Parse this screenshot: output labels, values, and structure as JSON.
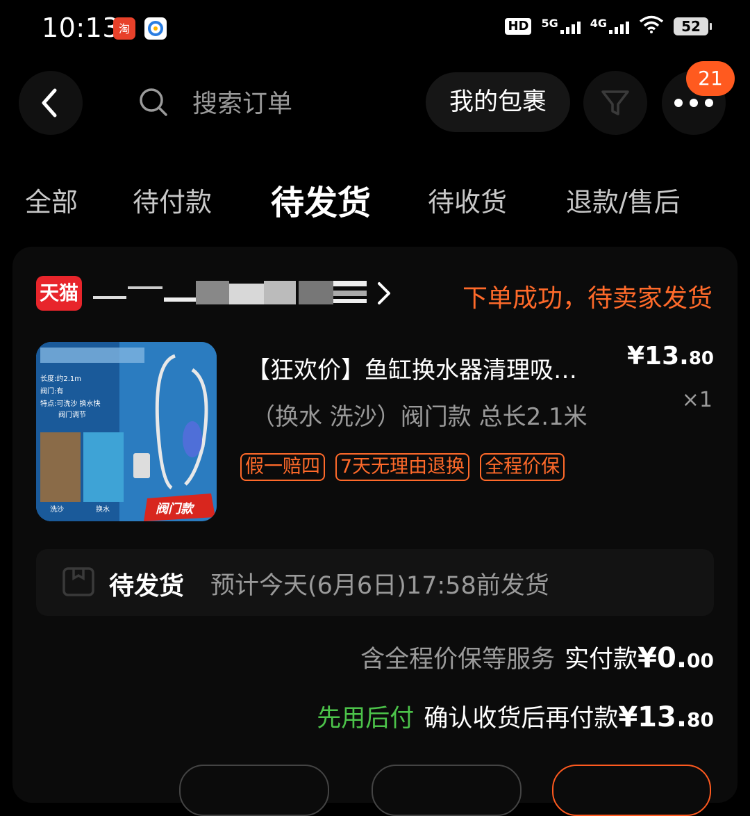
{
  "status_bar": {
    "time": "10:13",
    "hd": "HD",
    "net1": "5G",
    "net2": "4G",
    "battery": "52"
  },
  "search": {
    "placeholder": "搜索订单",
    "packages_label": "我的包裹",
    "more_badge": "21"
  },
  "tabs": [
    {
      "label": "全部"
    },
    {
      "label": "待付款"
    },
    {
      "label": "待发货"
    },
    {
      "label": "待收货"
    },
    {
      "label": "退款/售后"
    }
  ],
  "active_tab": "待发货",
  "order": {
    "platform_badge": "天猫",
    "status": "下单成功，待卖家发货",
    "item": {
      "title": "【狂欢价】鱼缸换水器清理吸…",
      "sku": "（换水 洗沙）阀门款 总长2.1米",
      "price_main": "¥13.",
      "price_cents": "80",
      "qty": "×1",
      "tags": [
        "假一赔四",
        "7天无理由退换",
        "全程价保"
      ],
      "thumb_text": {
        "length": "长度:约2.1m",
        "valve": "阀门:有",
        "feature": "特点:可洗沙 换水快",
        "feature2": "阀门调节",
        "wash": "洗沙",
        "change": "换水",
        "badge": "阀门款"
      }
    },
    "shipping": {
      "label": "待发货",
      "eta": "预计今天(6月6日)17:58前发货"
    },
    "payment": {
      "service_text": "含全程价保等服务",
      "paid_label": "实付款",
      "paid_main": "¥0.",
      "paid_cents": "00",
      "later_label": "先用后付",
      "later_text": "确认收货后再付款",
      "later_main": "¥13.",
      "later_cents": "80"
    }
  },
  "colors": {
    "accent": "#ff6a2a",
    "badge": "#ff5a1f",
    "tmall": "#e8252b",
    "green": "#4cc34a"
  }
}
